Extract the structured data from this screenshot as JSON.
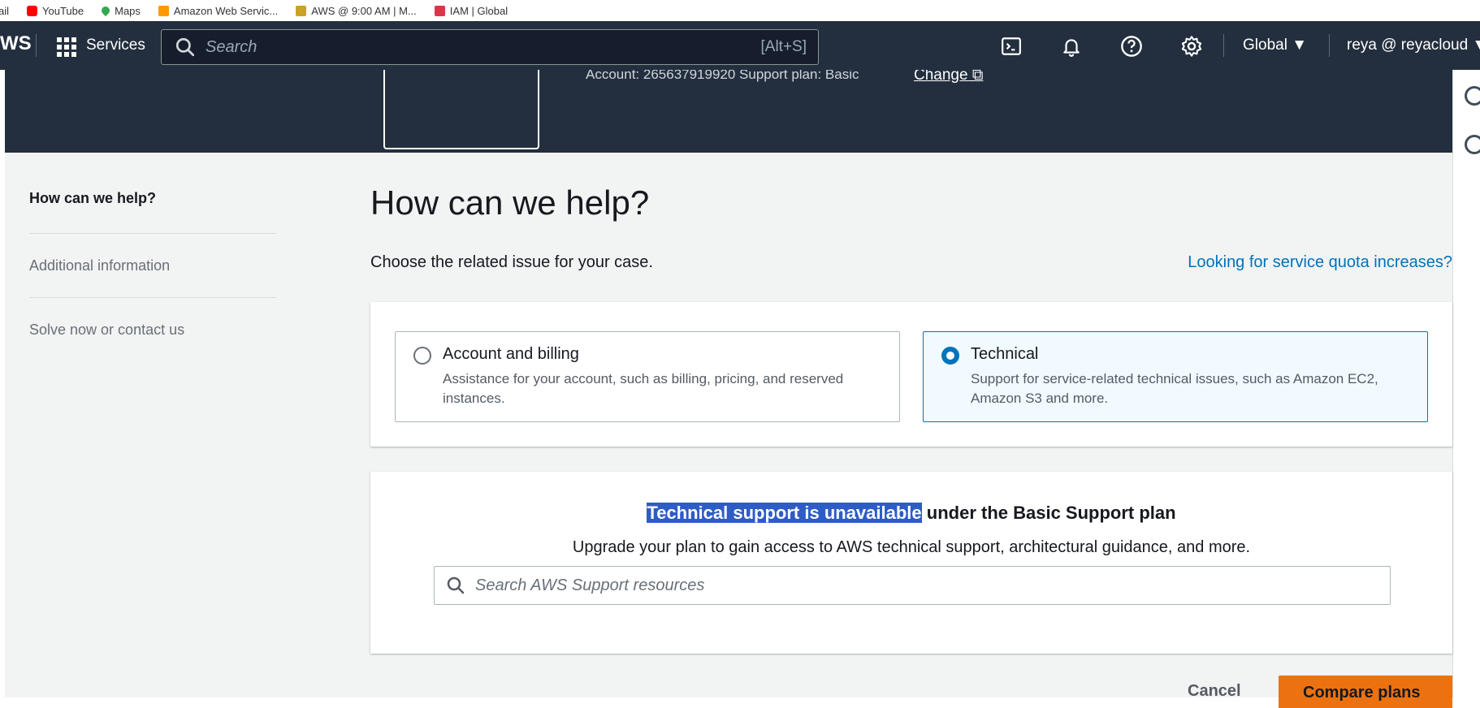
{
  "bookmarks": [
    {
      "label": "ail",
      "color": ""
    },
    {
      "label": "YouTube",
      "color": "#ff0000"
    },
    {
      "label": "Maps",
      "color": "#34a853"
    },
    {
      "label": "Amazon Web Servic...",
      "color": "#ff9900"
    },
    {
      "label": "AWS @ 9:00 AM | M...",
      "color": "#c9a227"
    },
    {
      "label": "IAM | Global",
      "color": "#dd344c"
    }
  ],
  "topnav": {
    "logo": "WS",
    "services_label": "Services",
    "search_placeholder": "Search",
    "search_shortcut": "[Alt+S]",
    "region": "Global ▼",
    "user": "reya @ reyacloud ▼"
  },
  "banner": {
    "account_line": "Account: 265637919920    Support plan: Basic",
    "change_link": "Change"
  },
  "sidenav": {
    "items": [
      {
        "label": "How can we help?"
      },
      {
        "label": "Additional information"
      },
      {
        "label": "Solve now or contact us"
      }
    ]
  },
  "main": {
    "title": "How can we help?",
    "subtitle": "Choose the related issue for your case.",
    "quota_link": "Looking for service quota increases?",
    "options": [
      {
        "title": "Account and billing",
        "description": "Assistance for your account, such as billing, pricing, and reserved instances.",
        "selected": false
      },
      {
        "title": "Technical",
        "description": "Support for service-related technical issues, such as Amazon EC2, Amazon S3 and more.",
        "selected": true
      }
    ],
    "unavailable_highlight": "Technical support is unavailable",
    "unavailable_rest": " under the Basic Support plan",
    "upgrade_text": "Upgrade your plan to gain access to AWS technical support, architectural guidance, and more.",
    "support_search_placeholder": "Search AWS Support resources",
    "cancel_label": "Cancel",
    "compare_label": "Compare plans"
  },
  "colors": {
    "nav_bg": "#232f3e",
    "link": "#0073bb",
    "primary_button": "#ec7211",
    "selection": "#2e5cc7"
  }
}
